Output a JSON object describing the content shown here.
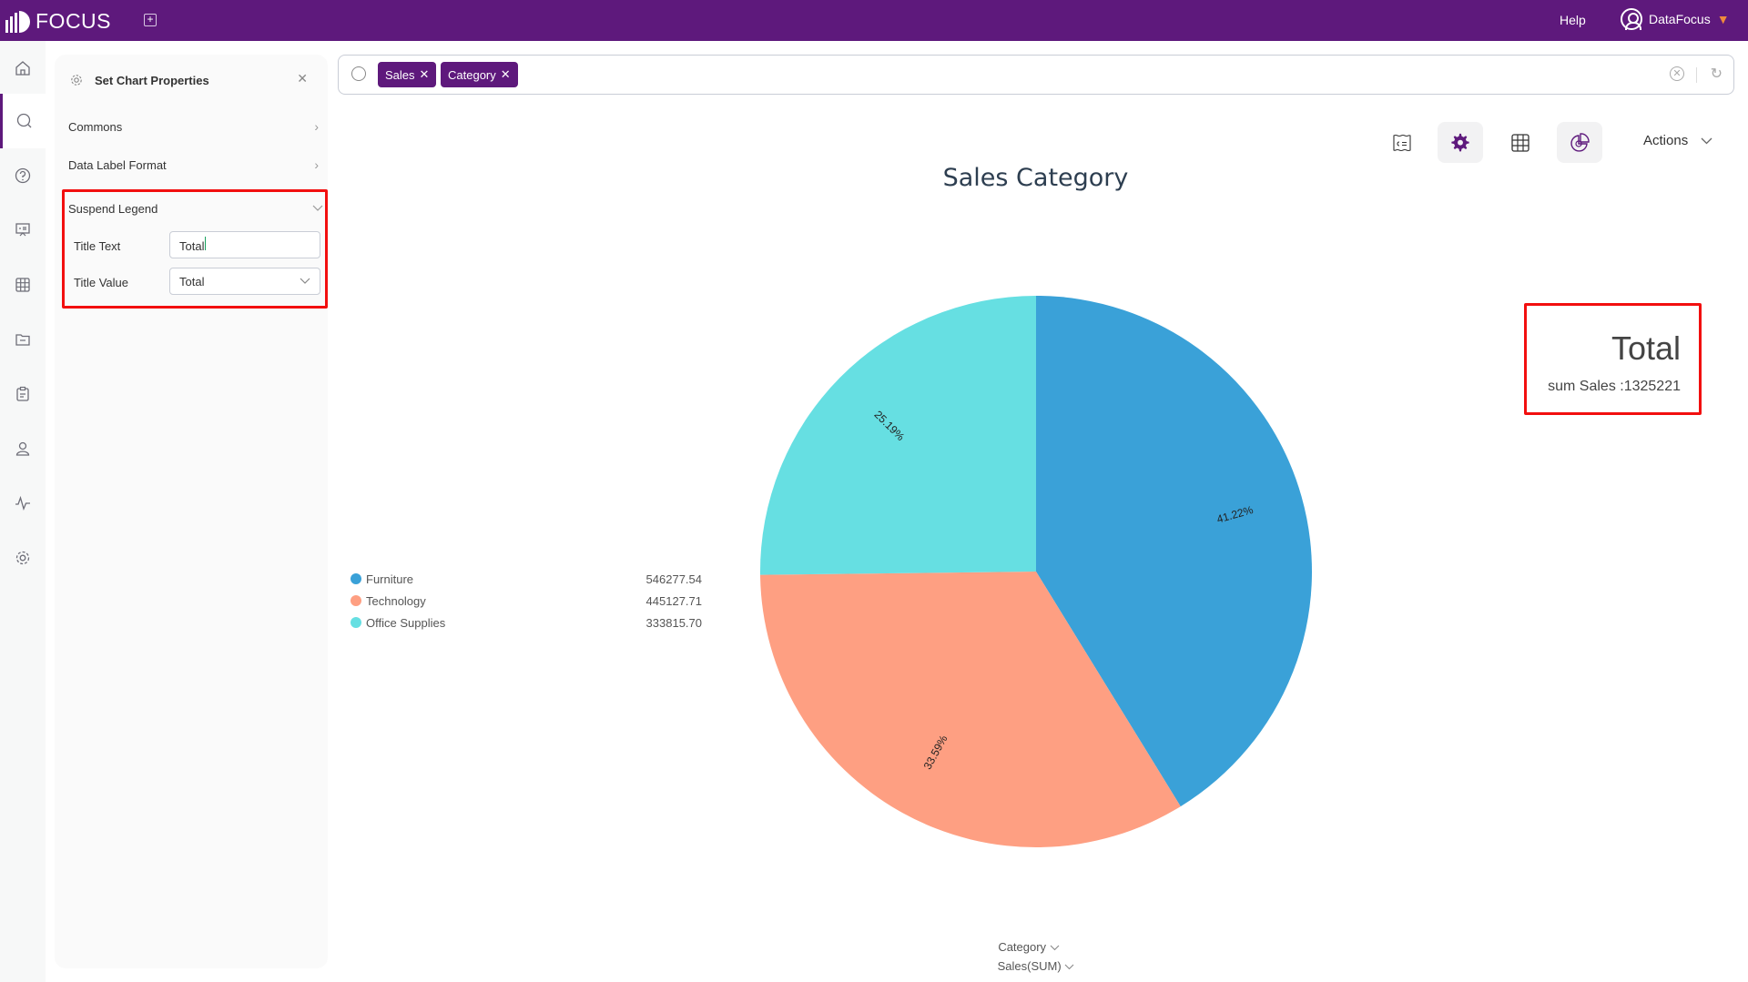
{
  "topbar": {
    "app_name": "FOCUS",
    "help_label": "Help",
    "user_name": "DataFocus"
  },
  "leftnav": {
    "items": [
      {
        "name": "home",
        "icon": "home-icon",
        "active": false
      },
      {
        "name": "search",
        "icon": "search-icon",
        "active": true
      },
      {
        "name": "help",
        "icon": "question-icon",
        "active": false
      },
      {
        "name": "presentation",
        "icon": "presentation-icon",
        "active": false
      },
      {
        "name": "table",
        "icon": "table-icon",
        "active": false
      },
      {
        "name": "folder",
        "icon": "folder-icon",
        "active": false
      },
      {
        "name": "clipboard",
        "icon": "clipboard-icon",
        "active": false
      },
      {
        "name": "user",
        "icon": "user-icon",
        "active": false
      },
      {
        "name": "monitor",
        "icon": "pulse-icon",
        "active": false
      },
      {
        "name": "settings",
        "icon": "gear-icon",
        "active": false
      }
    ]
  },
  "panel": {
    "title": "Set Chart Properties",
    "sections": [
      {
        "label": "Commons"
      },
      {
        "label": "Data Label Format"
      },
      {
        "label": "Suspend Legend"
      }
    ],
    "suspend_legend": {
      "title_text_label": "Title Text",
      "title_text_value": "Total",
      "title_value_label": "Title Value",
      "title_value_selected": "Total"
    }
  },
  "search": {
    "tokens": [
      {
        "label": "Sales"
      },
      {
        "label": "Category"
      }
    ]
  },
  "toolbar": {
    "actions_label": "Actions"
  },
  "colors": {
    "brand": "#5e197c",
    "highlight_box": "#f20f0f"
  },
  "suspend_legend_display": {
    "title": "Total",
    "value": "sum Sales :1325221"
  },
  "axis": {
    "category_label": "Category",
    "value_label": "Sales(SUM)"
  },
  "chart_data": {
    "type": "pie",
    "title": "Sales Category",
    "categories": [
      "Furniture",
      "Technology",
      "Office Supplies"
    ],
    "values": [
      546277.54,
      445127.71,
      333815.7
    ],
    "value_labels": [
      "546277.54",
      "445127.71",
      "333815.70"
    ],
    "percent_labels": [
      "41.22%",
      "33.59%",
      "25.19%"
    ],
    "colors": [
      "#3aa1d8",
      "#fe9f82",
      "#66dfe2"
    ],
    "legend_position": "left",
    "total": 1325221
  }
}
